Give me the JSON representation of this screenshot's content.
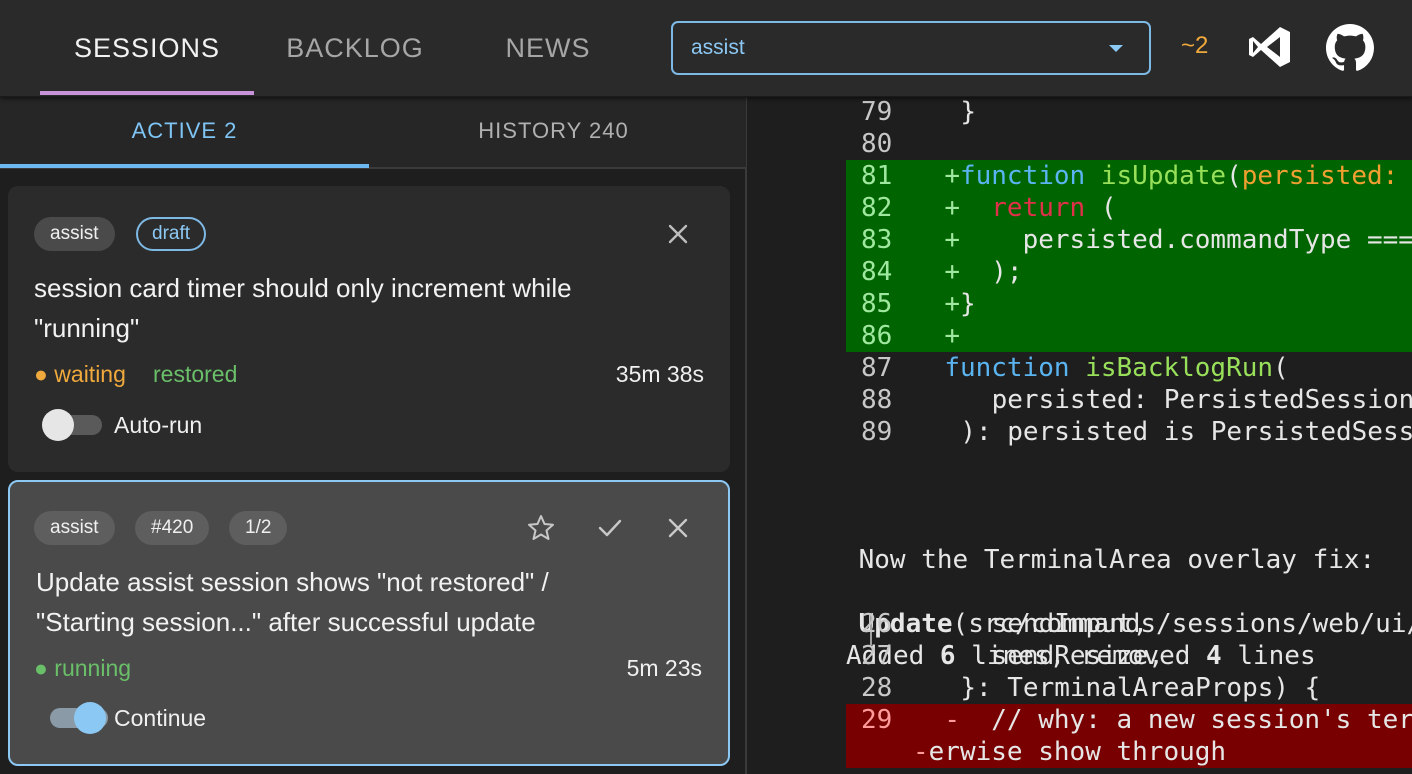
{
  "nav": {
    "tabs": [
      {
        "label": "SESSIONS",
        "active": true
      },
      {
        "label": "BACKLOG",
        "active": false
      },
      {
        "label": "NEWS",
        "active": false
      }
    ],
    "project_select": {
      "value": "assist"
    },
    "counter": "~2",
    "icons": [
      "vscode-icon",
      "github-icon"
    ]
  },
  "subtabs": [
    {
      "label": "ACTIVE 2",
      "active": true
    },
    {
      "label": "HISTORY 240",
      "active": false
    }
  ],
  "sessions": [
    {
      "chips": [
        "assist",
        "draft"
      ],
      "title_lines": [
        "session card timer should only increment while",
        "\"running\""
      ],
      "status": "waiting",
      "status_extra": "restored",
      "duration": "35m 38s",
      "toggle_label": "Auto-run",
      "toggle_on": false,
      "selected": false
    },
    {
      "chips": [
        "assist",
        "#420",
        "1/2"
      ],
      "title_lines": [
        "Update assist session shows \"not restored\" /",
        "\"Starting session...\" after successful update"
      ],
      "status": "running",
      "duration": "5m 23s",
      "toggle_label": "Continue",
      "toggle_on": true,
      "selected": true
    }
  ],
  "terminal": {
    "diff1": [
      {
        "n": "79",
        "type": "ctx",
        "text": "}"
      },
      {
        "n": "80",
        "type": "ctx",
        "text": ""
      },
      {
        "n": "81",
        "type": "add",
        "parts": [
          [
            "+",
            "mk"
          ],
          [
            "function",
            "kw"
          ],
          [
            " ",
            ""
          ],
          [
            "isUpdate",
            "fn"
          ],
          [
            "(",
            ""
          ],
          [
            "persisted: P",
            "prm"
          ]
        ]
      },
      {
        "n": "82",
        "type": "add",
        "parts": [
          [
            "+  ",
            "mk"
          ],
          [
            "return",
            "rkw"
          ],
          [
            " (",
            ""
          ]
        ]
      },
      {
        "n": "83",
        "type": "add",
        "parts": [
          [
            "+    ",
            "mk"
          ],
          [
            "persisted.commandType ===",
            ""
          ]
        ]
      },
      {
        "n": "84",
        "type": "add",
        "parts": [
          [
            "+  ",
            "mk"
          ],
          [
            ");",
            ""
          ]
        ]
      },
      {
        "n": "85",
        "type": "add",
        "parts": [
          [
            "+",
            "mk"
          ],
          [
            "}",
            ""
          ]
        ]
      },
      {
        "n": "86",
        "type": "add",
        "parts": [
          [
            "+",
            "mk"
          ]
        ]
      },
      {
        "n": "87",
        "type": "ctx",
        "parts": [
          [
            "function",
            "kw"
          ],
          [
            " ",
            ""
          ],
          [
            "isBacklogRun",
            "fn"
          ],
          [
            "(",
            ""
          ]
        ]
      },
      {
        "n": "88",
        "type": "ctx",
        "text": "  persisted: PersistedSession,"
      },
      {
        "n": "89",
        "type": "ctx",
        "text": "): persisted is PersistedSessi"
      }
    ],
    "msg1": "Now the TerminalArea overlay fix:",
    "update_tool": "Update",
    "update_arg": "(src/commands/sessions/web/ui/Te",
    "summary_parts": [
      "Added ",
      "6",
      " lines, removed ",
      "4",
      " lines"
    ],
    "diff2": [
      {
        "n": "26",
        "type": "ctx",
        "text": "  sendInput,"
      },
      {
        "n": "27",
        "type": "ctx",
        "text": "  sendResize,"
      },
      {
        "n": "28",
        "type": "ctx",
        "text": "}: TerminalAreaProps) {"
      },
      {
        "n": "29",
        "type": "del",
        "parts": [
          [
            "-  ",
            "mk"
          ],
          [
            "// why: a new session's term",
            ""
          ]
        ]
      },
      {
        "n": "",
        "type": "del",
        "parts": [
          [
            "-",
            "mk"
          ],
          [
            "erwise show through",
            ""
          ]
        ]
      }
    ]
  }
}
